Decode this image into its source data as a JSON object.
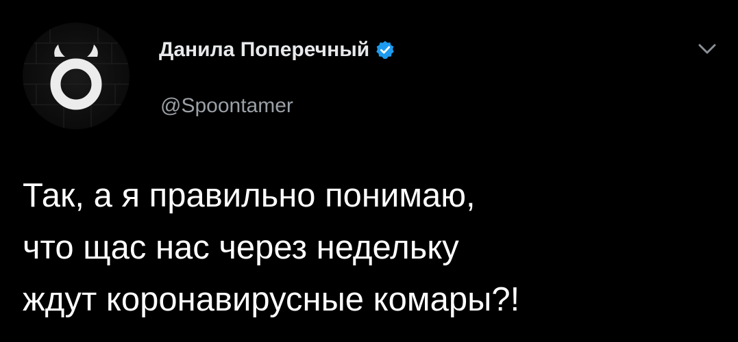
{
  "author": {
    "display_name": "Данила Поперечный",
    "handle": "@Spoontamer",
    "verified": true,
    "avatar_icon": "bull-ring-logo-icon"
  },
  "tweet": {
    "lines": [
      "Так, а я правильно понимаю,",
      "что щас нас через недельку",
      "ждут коронавирусные комары?!"
    ]
  },
  "colors": {
    "background": "#000000",
    "text": "#ffffff",
    "secondary_text": "#9aa0a6",
    "verified_badge": "#1d9bf0"
  }
}
